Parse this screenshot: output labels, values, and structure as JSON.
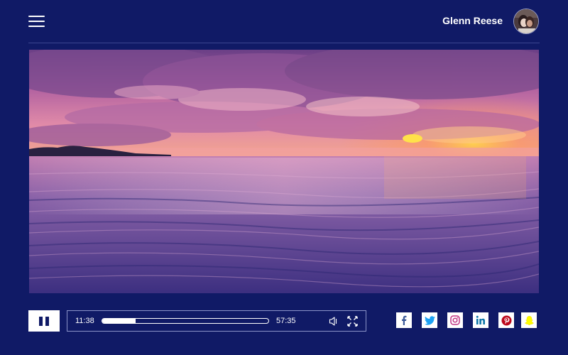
{
  "header": {
    "menu_icon": "hamburger-menu-icon",
    "user_name": "Glenn Reese",
    "avatar_icon": "user-avatar"
  },
  "player": {
    "current_time": "11:38",
    "total_time": "57:35",
    "progress": 0.2,
    "pause_icon": "pause-icon",
    "volume_icon": "volume-icon",
    "fullscreen_icon": "fullscreen-icon"
  },
  "social": [
    {
      "name": "facebook",
      "icon": "facebook-icon",
      "color": "#3b5998"
    },
    {
      "name": "twitter",
      "icon": "twitter-icon",
      "color": "#1da1f2"
    },
    {
      "name": "instagram",
      "icon": "instagram-icon",
      "color": "#c13584"
    },
    {
      "name": "linkedin",
      "icon": "linkedin-icon",
      "color": "#0e76a8"
    },
    {
      "name": "pinterest",
      "icon": "pinterest-icon",
      "color": "#bd081c"
    },
    {
      "name": "snapchat",
      "icon": "snapchat-icon",
      "color": "#fffc00"
    }
  ],
  "colors": {
    "background": "#101a66",
    "accent": "#ffffff"
  }
}
